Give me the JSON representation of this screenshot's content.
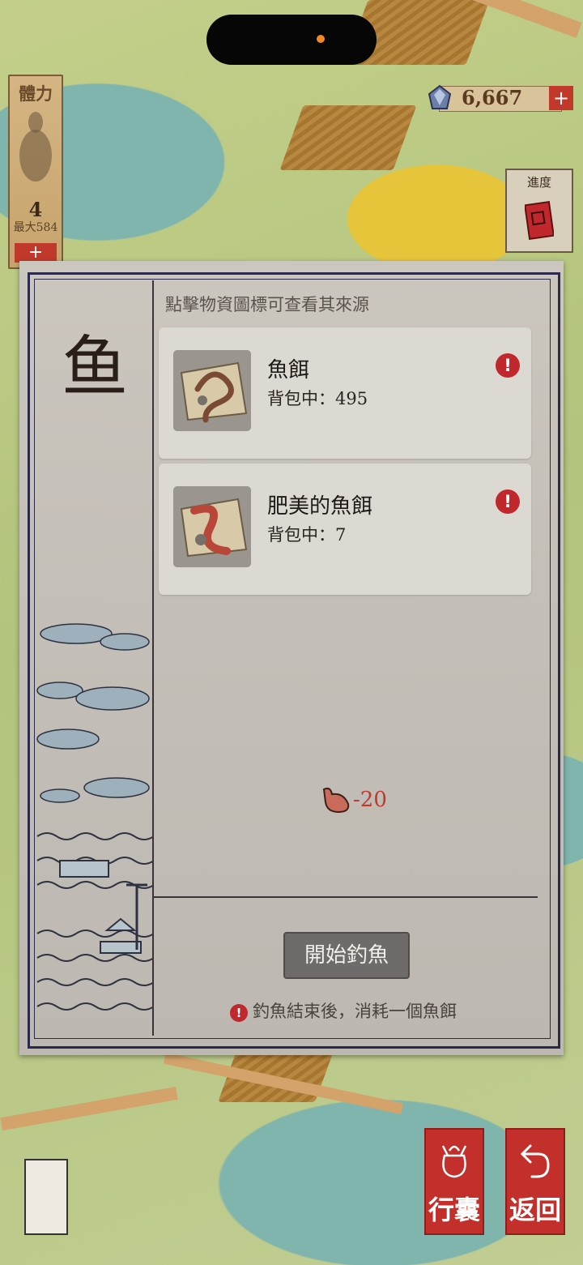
{
  "hud": {
    "stamina": {
      "title": "體力",
      "value": "4",
      "max_label": "最大584",
      "add": "+"
    },
    "currency": {
      "value": "6,667",
      "add": "+"
    },
    "progress": {
      "label": "進度"
    }
  },
  "dialog": {
    "category": "鱼",
    "hint": "點擊物資圖標可查看其來源",
    "items": [
      {
        "name": "魚餌",
        "count_label": "背包中：495",
        "alert": "!"
      },
      {
        "name": "肥美的魚餌",
        "count_label": "背包中：7",
        "alert": "!"
      }
    ],
    "stamina_cost": "-20",
    "start_button": "開始釣魚",
    "note": {
      "alert": "!",
      "text": "釣魚結束後，消耗一個魚餌"
    }
  },
  "bottom_buttons": {
    "bag": {
      "label": "行囊"
    },
    "back": {
      "label": "返回"
    }
  },
  "colors": {
    "accent_red": "#c0282d",
    "panel": "#c9c4bd",
    "ink": "#2a1e18"
  }
}
